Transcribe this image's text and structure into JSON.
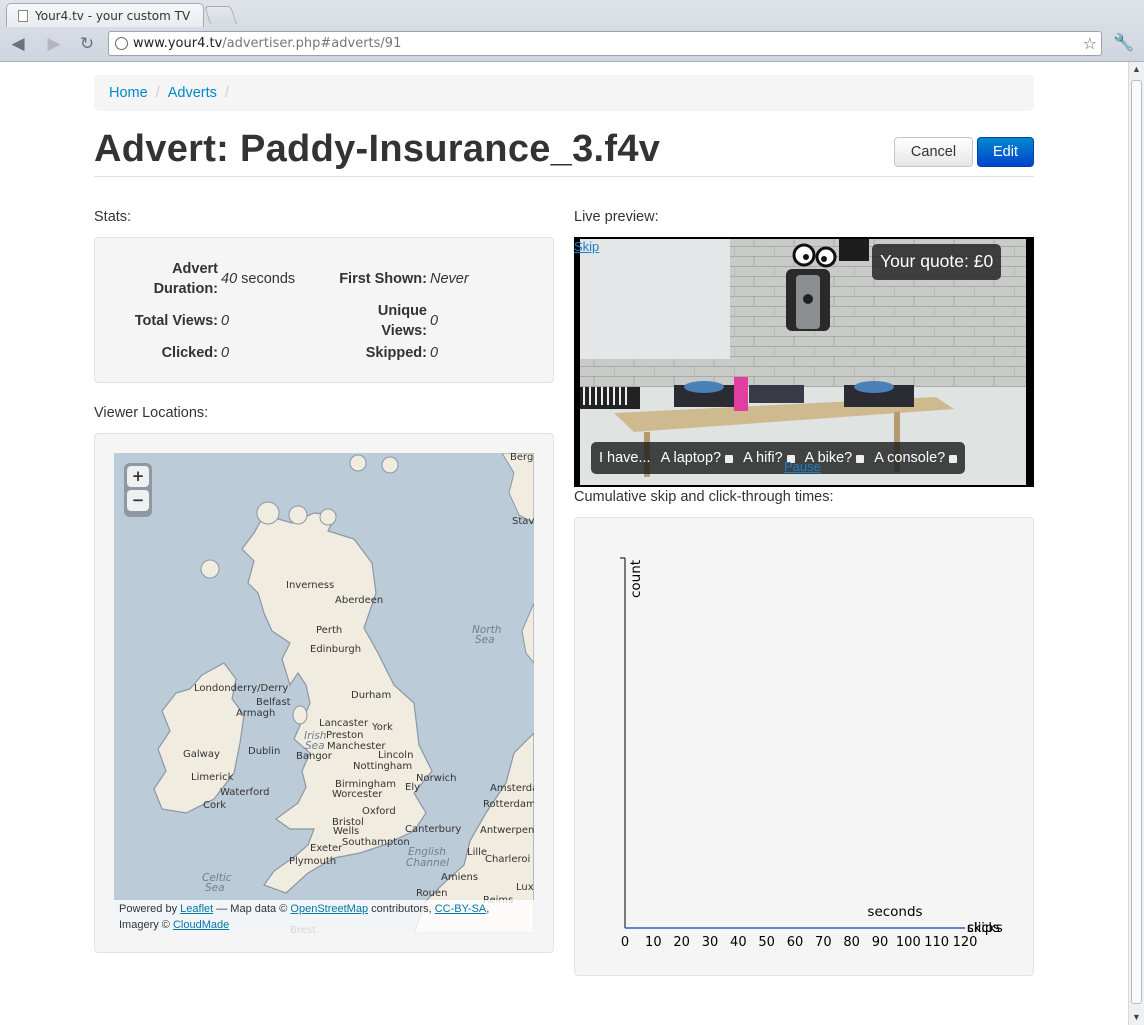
{
  "browser": {
    "tab_title": "Your4.tv - your custom TV",
    "url_host": "www.your4.tv",
    "url_path": "/advertiser.php#adverts/91"
  },
  "breadcrumb": {
    "home": "Home",
    "adverts": "Adverts",
    "separator": "/"
  },
  "page_title": "Advert: Paddy-Insurance_3.f4v",
  "actions": {
    "cancel": "Cancel",
    "edit": "Edit"
  },
  "stats": {
    "heading": "Stats:",
    "advert_duration_label": "Advert Duration:",
    "advert_duration_value": "40",
    "advert_duration_unit": "seconds",
    "first_shown_label": "First Shown:",
    "first_shown_value": "Never",
    "total_views_label": "Total Views:",
    "total_views_value": "0",
    "unique_views_label": "Unique Views:",
    "unique_views_value": "0",
    "clicked_label": "Clicked:",
    "clicked_value": "0",
    "skipped_label": "Skipped:",
    "skipped_value": "0"
  },
  "viewer_locations": {
    "heading": "Viewer Locations:",
    "zoom_in": "+",
    "zoom_out": "−",
    "attribution": {
      "powered_by": "Powered by",
      "leaflet": "Leaflet",
      "map_data": "— Map data ©",
      "osm": "OpenStreetMap",
      "contributors": "contributors,",
      "license": "CC-BY-SA",
      "imagery": ", Imagery ©",
      "cloudmade": "CloudMade"
    },
    "places": [
      "Bergen",
      "Stavanger",
      "Inverness",
      "Aberdeen",
      "Perth",
      "Edinburgh",
      "Londonderry/Derry",
      "Belfast",
      "Armagh",
      "Durham",
      "Lancaster",
      "York",
      "Preston",
      "Manchester",
      "Lincoln",
      "Bangor",
      "Galway",
      "Dublin",
      "Nottingham",
      "Limerick",
      "Birmingham",
      "Norwich",
      "Worcester",
      "Ely",
      "Amsterdam",
      "Waterford",
      "Cork",
      "Oxford",
      "Rotterdam",
      "Bristol",
      "Wells",
      "Canterbury",
      "Antwerpen",
      "Southampton",
      "Exeter",
      "Lille",
      "Charleroi",
      "Plymouth",
      "Amiens",
      "Rouen",
      "Reims",
      "Brest",
      "Luxe"
    ],
    "seas": [
      "North Sea",
      "Irish Sea",
      "English Channel",
      "Celtic Sea"
    ]
  },
  "live_preview": {
    "heading": "Live preview:",
    "skip_link": "Skip",
    "pause_link": "Pause",
    "quote": "Your quote: £0",
    "prompt": "I have...",
    "options": [
      "A laptop?",
      "A hifi?",
      "A bike?",
      "A console?"
    ]
  },
  "cumulative": {
    "heading": "Cumulative skip and click-through times:"
  },
  "chart_data": {
    "type": "line",
    "title": "",
    "xlabel": "seconds",
    "ylabel": "count",
    "x_ticks": [
      0,
      10,
      20,
      30,
      40,
      50,
      60,
      70,
      80,
      90,
      100,
      110,
      120
    ],
    "xlim": [
      0,
      120
    ],
    "series": [
      {
        "name": "skips",
        "color": "#e8833a",
        "x": [
          0,
          120
        ],
        "values": [
          0,
          0
        ]
      },
      {
        "name": "clicks",
        "color": "#3a6fd8",
        "x": [
          0,
          120
        ],
        "values": [
          0,
          0
        ]
      }
    ]
  },
  "colors": {
    "link": "#0088cc",
    "primary_button": "#0055cc",
    "well": "#f5f5f5"
  }
}
